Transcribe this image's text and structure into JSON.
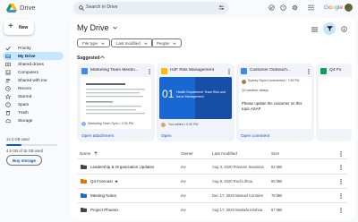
{
  "app": {
    "title": "Drive",
    "brand": "Google"
  },
  "search": {
    "placeholder": "Search in Drive"
  },
  "sidebar": {
    "new_label": "New",
    "items": [
      {
        "label": "Priority"
      },
      {
        "label": "My Drive"
      },
      {
        "label": "Shared drives"
      },
      {
        "label": "Computers"
      },
      {
        "label": "Shared with me"
      },
      {
        "label": "Recent"
      },
      {
        "label": "Starred"
      },
      {
        "label": "Spam"
      },
      {
        "label": "Trash"
      },
      {
        "label": "Storage"
      }
    ],
    "storage_label": "12.3 GB used",
    "storage_used": "4.5 GB of 15 GB used",
    "storage_fraction": 0.3,
    "buy_label": "Buy storage"
  },
  "main": {
    "title": "My Drive",
    "filters": [
      "File type",
      "Last modified",
      "People"
    ],
    "suggested_label": "Suggested",
    "cards": [
      {
        "title": "Marketing Team Meetin...",
        "meta": "Marketing Team Sync • 2:30 PM",
        "action": "Open attachment"
      },
      {
        "title": "H2F Risk Management",
        "big_num": "01",
        "body": "Health Department Team Risk and Issue Management",
        "meta": "You edited • 9:30 PM",
        "action": "Open"
      },
      {
        "title": "Customer Outreach...",
        "commenter": "Sydney Taylor commented • 7:05 PM",
        "sub": "Q4 weather delays",
        "comment": "Please update the customer on this topic ASAP",
        "action": "Open comment"
      },
      {
        "title": "Q4 Fo"
      }
    ],
    "table": {
      "headers": {
        "name": "Name",
        "owner": "Owner",
        "modified": "Last modified",
        "size": "Size"
      },
      "rows": [
        {
          "name": "Leadership & Organization Updates",
          "owner": "me",
          "modified": "Aug 3, 2020 Praveen Swamina",
          "size": "82 MB",
          "color": "#444746"
        },
        {
          "name": "Q4 Forecast",
          "starred": "★",
          "owner": "me",
          "modified": "Aug 9, 2020 Ruchi Zhou",
          "size": "66 MB",
          "color": "#e37400"
        },
        {
          "name": "Meeting Notes",
          "owner": "me",
          "modified": "Dec 17, 2020 Manuel Corrales",
          "size": "78 MB",
          "color": "#1967d2"
        },
        {
          "name": "Project Phoenix",
          "owner": "me",
          "modified": "Aug 17, 2020 Mustafa Krishna",
          "size": "67 MB",
          "color": "#444746"
        }
      ]
    }
  },
  "colors": {
    "accent": "#0b57d0",
    "active_nav": "#c2e7ff",
    "card_bg": "#f0f4f9",
    "slides_blue": "#1967d2",
    "slides_dark": "#174ea6"
  }
}
